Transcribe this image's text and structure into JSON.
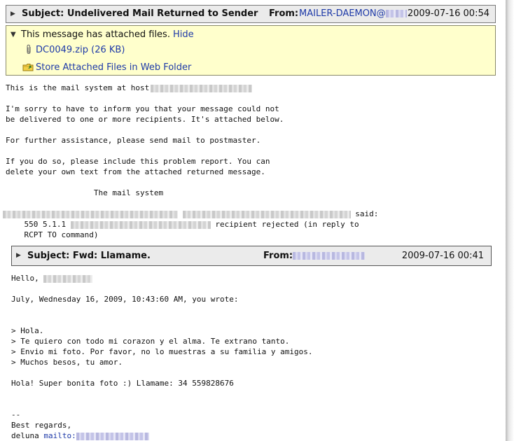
{
  "message": {
    "subject": "Subject: Undelivered Mail Returned to Sender",
    "from_label": "From:",
    "from_value": "MAILER-DAEMON@",
    "date": "2009-07-16 00:54"
  },
  "attachments": {
    "notice": "This message has attached files.",
    "hide_label": "Hide",
    "file": "DC0049.zip (26 KB)",
    "store_label": "Store Attached Files in Web Folder"
  },
  "body": {
    "l1": "This is the mail system at host",
    "l2": "I'm sorry to have to inform you that your message could not",
    "l3": "be delivered to one or more recipients. It's attached below.",
    "l4": "For further assistance, please send mail to postmaster.",
    "l5": "If you do so, please include this problem report. You can",
    "l6": "delete your own text from the attached returned message.",
    "l7": "                   The mail system",
    "said": "said:",
    "l8a": "    550 5.1.1",
    "l8b": "recipient rejected (in reply to",
    "l9": "    RCPT TO command)"
  },
  "forwarded": {
    "subject": "Subject: Fwd: Llamame.",
    "from_label": "From:",
    "date": "2009-07-16 00:41",
    "hello": "Hello,",
    "wrote": "July, Wednesday 16, 2009, 10:43:60 AM, you wrote:",
    "q1": "> Hola.",
    "q2": "> Te quiero con todo mi corazon y el alma. Te extrano tanto.",
    "q3": "> Envio mi foto. Por favor, no lo muestras a su familia y amigos.",
    "q4": "> Muchos besos, tu amor.",
    "reply": "Hola! Super bonita foto :) Llamame: 34 559828676",
    "sig_dash": "--",
    "regards": "Best regards,",
    "name": "deluna",
    "mailto": "mailto:"
  }
}
